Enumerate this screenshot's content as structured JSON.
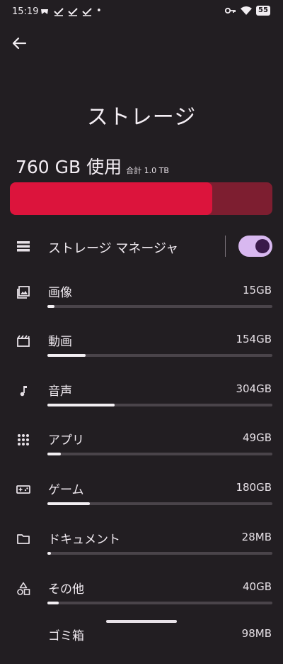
{
  "status_bar": {
    "time": "15:19",
    "dot": "•",
    "battery": "55"
  },
  "page": {
    "title": "ストレージ"
  },
  "summary": {
    "used": "760 GB 使用",
    "total": "合計 1.0 TB",
    "used_fraction": 0.77
  },
  "manager": {
    "label": "ストレージ マネージャ",
    "enabled": true
  },
  "categories": [
    {
      "label": "画像",
      "size": "15GB",
      "fraction": 0.03,
      "icon": "image-icon"
    },
    {
      "label": "動画",
      "size": "154GB",
      "fraction": 0.17,
      "icon": "movie-icon"
    },
    {
      "label": "音声",
      "size": "304GB",
      "fraction": 0.3,
      "icon": "music-note-icon"
    },
    {
      "label": "アプリ",
      "size": "49GB",
      "fraction": 0.06,
      "icon": "apps-grid-icon"
    },
    {
      "label": "ゲーム",
      "size": "180GB",
      "fraction": 0.19,
      "icon": "gamepad-icon"
    },
    {
      "label": "ドキュメント",
      "size": "28MB",
      "fraction": 0.0,
      "icon": "folder-icon"
    },
    {
      "label": "その他",
      "size": "40GB",
      "fraction": 0.05,
      "icon": "shapes-icon"
    },
    {
      "label": "ゴミ箱",
      "size": "98MB",
      "fraction": 0.0,
      "icon": "trash-icon"
    }
  ]
}
